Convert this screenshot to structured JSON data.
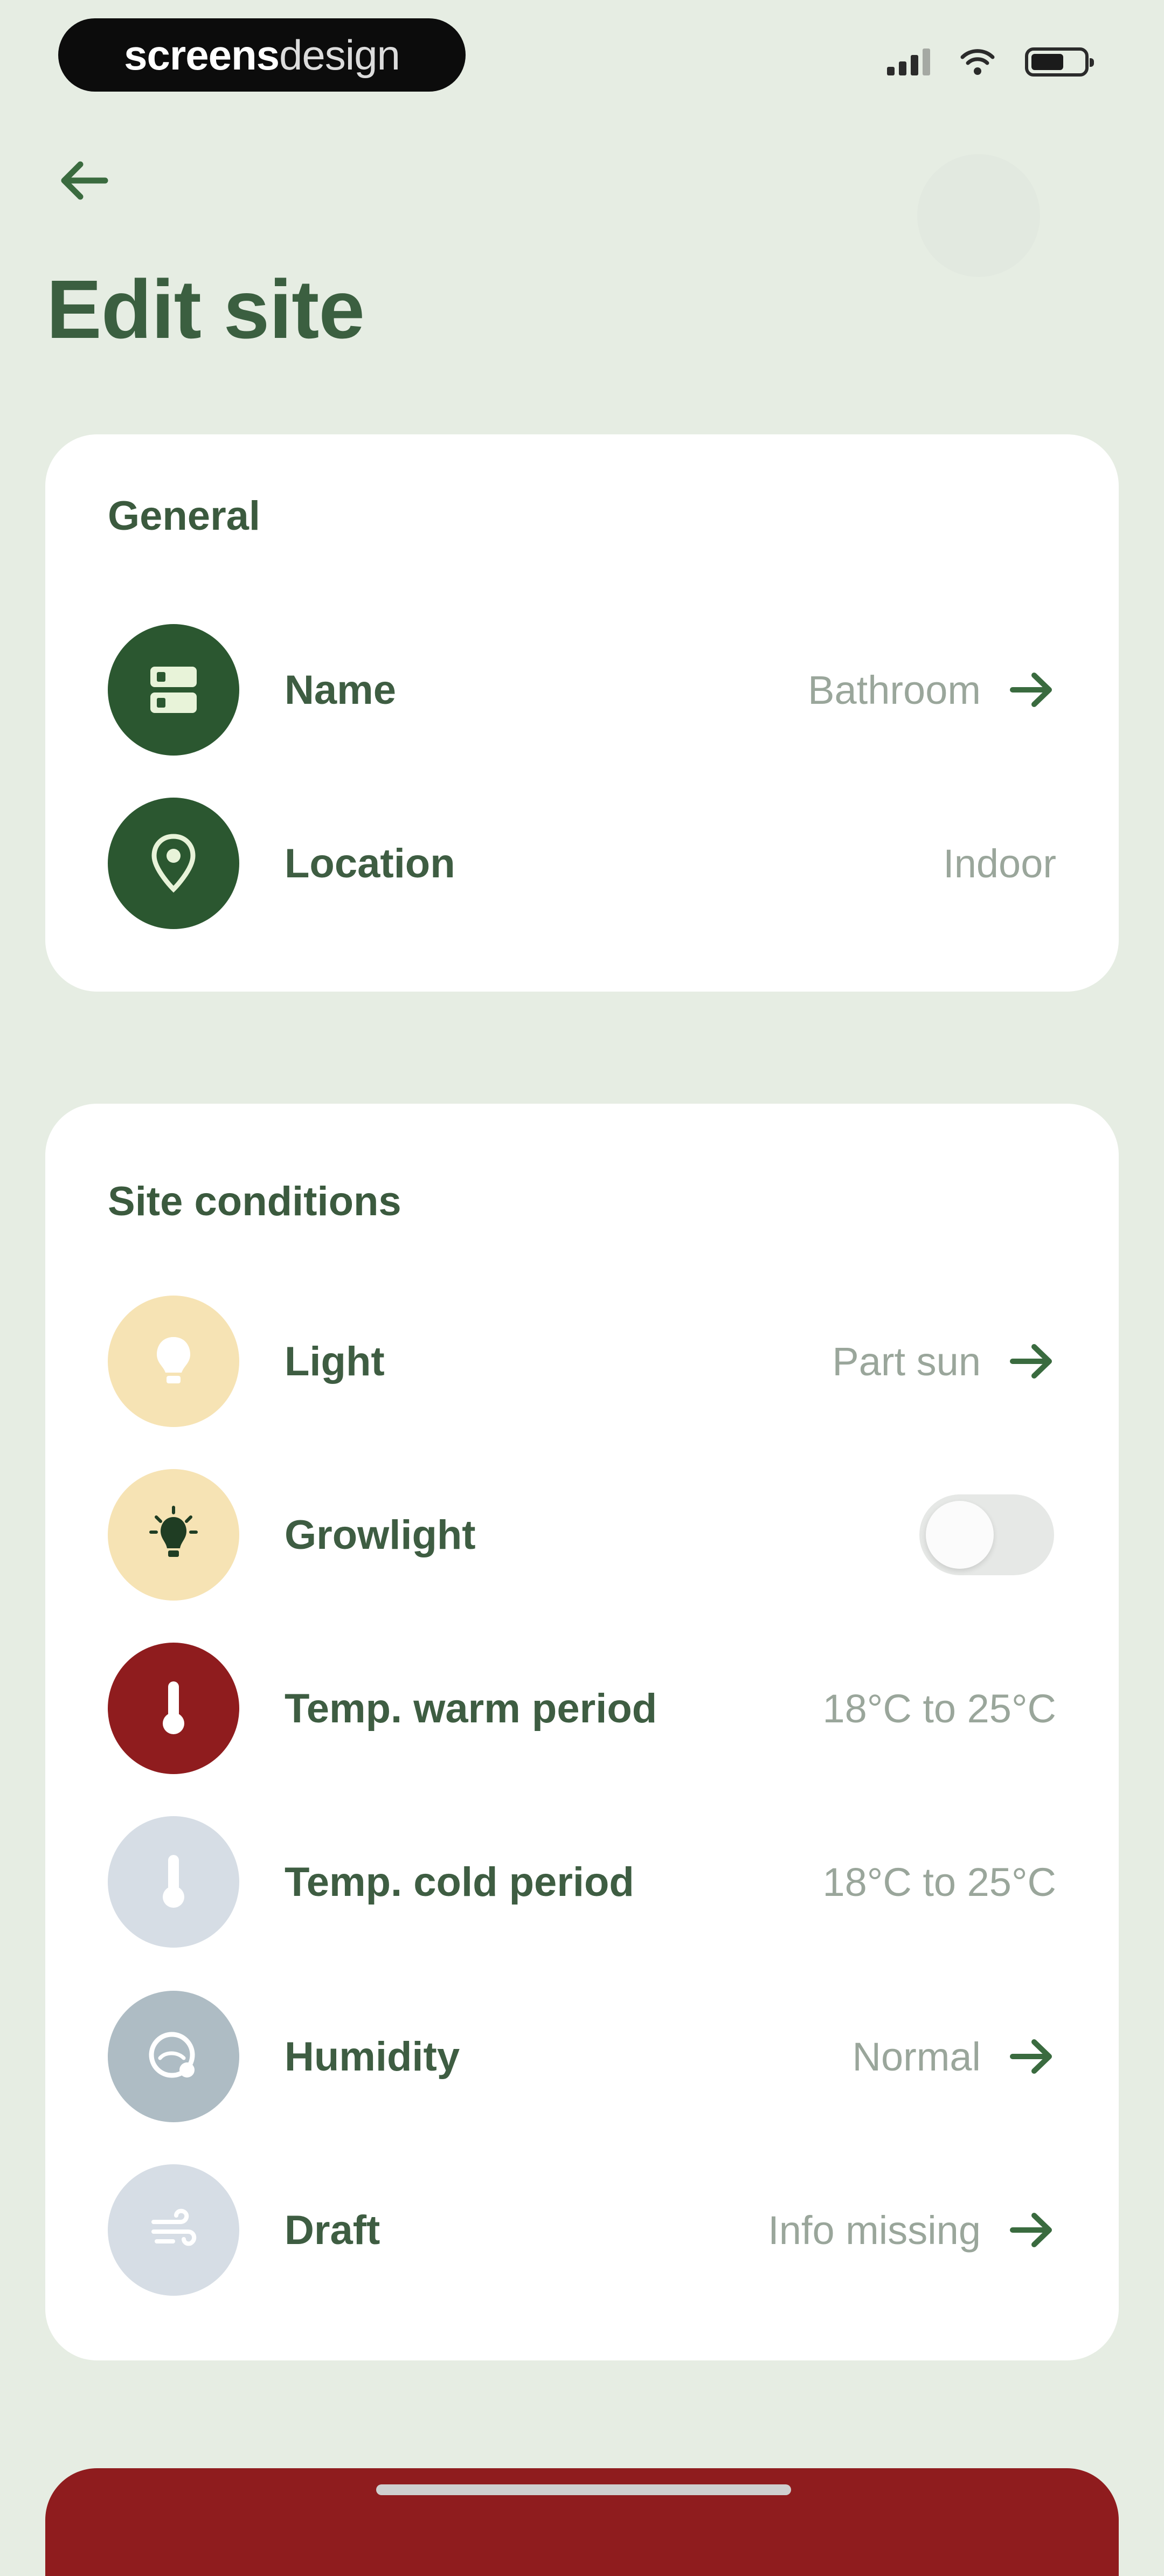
{
  "status_bar": {
    "brand_bold": "screens",
    "brand_light": "design"
  },
  "header": {
    "title": "Edit site"
  },
  "general": {
    "title": "General",
    "rows": [
      {
        "label": "Name",
        "value": "Bathroom"
      },
      {
        "label": "Location",
        "value": "Indoor"
      }
    ]
  },
  "site_conditions": {
    "title": "Site conditions",
    "rows": [
      {
        "label": "Light",
        "value": "Part sun"
      },
      {
        "label": "Growlight",
        "value": ""
      },
      {
        "label": "Temp. warm period",
        "value": "18°C to 25°C"
      },
      {
        "label": "Temp. cold period",
        "value": "18°C to 25°C"
      },
      {
        "label": "Humidity",
        "value": "Normal"
      },
      {
        "label": "Draft",
        "value": "Info missing"
      }
    ]
  },
  "toggles": {
    "growlight_on": false
  },
  "colors": {
    "background": "#e6ede3",
    "dark_green": "#2b5730",
    "light_yellow": "#f6e3b4",
    "dark_red": "#8f1c1e",
    "pale_blue": "#d6dde5",
    "gray_blue": "#aebcc4"
  }
}
